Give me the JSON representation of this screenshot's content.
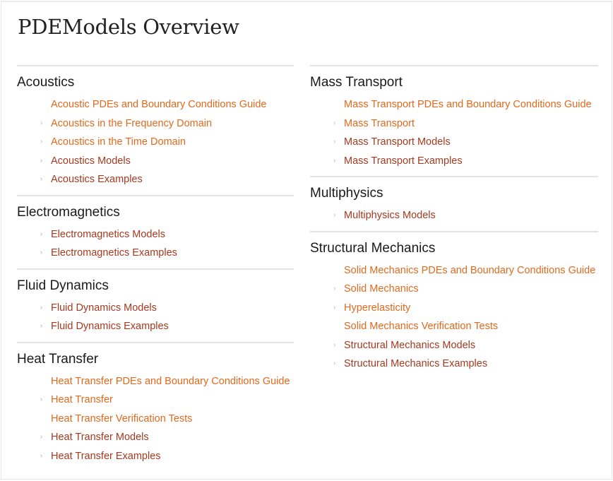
{
  "page": {
    "title": "PDEModels Overview"
  },
  "colors": {
    "guide_link": "#e2691c",
    "model_link": "#a6391e",
    "heading": "#1a1a1a",
    "divider": "#e3e3e3"
  },
  "columns": {
    "left": [
      {
        "title": "Acoustics",
        "links": [
          {
            "label": "Acoustic PDEs and Boundary Conditions Guide",
            "kind": "guide",
            "bullet": false
          },
          {
            "label": "Acoustics in the Frequency Domain",
            "kind": "guide",
            "bullet": true
          },
          {
            "label": "Acoustics in the Time Domain",
            "kind": "guide",
            "bullet": true
          },
          {
            "label": "Acoustics Models",
            "kind": "model",
            "bullet": true
          },
          {
            "label": "Acoustics Examples",
            "kind": "model",
            "bullet": true
          }
        ]
      },
      {
        "title": "Electromagnetics",
        "links": [
          {
            "label": "Electromagnetics Models",
            "kind": "model",
            "bullet": true
          },
          {
            "label": "Electromagnetics Examples",
            "kind": "model",
            "bullet": true
          }
        ]
      },
      {
        "title": "Fluid Dynamics",
        "links": [
          {
            "label": "Fluid Dynamics Models",
            "kind": "model",
            "bullet": true
          },
          {
            "label": "Fluid Dynamics Examples",
            "kind": "model",
            "bullet": true
          }
        ]
      },
      {
        "title": "Heat Transfer",
        "links": [
          {
            "label": "Heat Transfer PDEs and Boundary Conditions Guide",
            "kind": "guide",
            "bullet": false
          },
          {
            "label": "Heat Transfer",
            "kind": "guide",
            "bullet": true
          },
          {
            "label": "Heat Transfer Verification Tests",
            "kind": "guide",
            "bullet": false
          },
          {
            "label": "Heat Transfer Models",
            "kind": "model",
            "bullet": true
          },
          {
            "label": "Heat Transfer Examples",
            "kind": "model",
            "bullet": true
          }
        ]
      }
    ],
    "right": [
      {
        "title": "Mass Transport",
        "links": [
          {
            "label": "Mass Transport PDEs and Boundary Conditions Guide",
            "kind": "guide",
            "bullet": false
          },
          {
            "label": "Mass Transport",
            "kind": "guide",
            "bullet": true
          },
          {
            "label": "Mass Transport Models",
            "kind": "model",
            "bullet": true
          },
          {
            "label": "Mass Transport Examples",
            "kind": "model",
            "bullet": true
          }
        ]
      },
      {
        "title": "Multiphysics",
        "links": [
          {
            "label": "Multiphysics Models",
            "kind": "model",
            "bullet": true
          }
        ]
      },
      {
        "title": "Structural Mechanics",
        "links": [
          {
            "label": "Solid Mechanics PDEs and Boundary Conditions Guide",
            "kind": "guide",
            "bullet": false
          },
          {
            "label": "Solid Mechanics",
            "kind": "guide",
            "bullet": true
          },
          {
            "label": "Hyperelasticity",
            "kind": "guide",
            "bullet": true
          },
          {
            "label": "Solid Mechanics Verification Tests",
            "kind": "guide",
            "bullet": false
          },
          {
            "label": "Structural Mechanics Models",
            "kind": "model",
            "bullet": true
          },
          {
            "label": "Structural Mechanics Examples",
            "kind": "model",
            "bullet": true
          }
        ]
      }
    ]
  },
  "icons": {
    "bullet": "chevron-right-icon",
    "bullet_glyph": "›"
  }
}
